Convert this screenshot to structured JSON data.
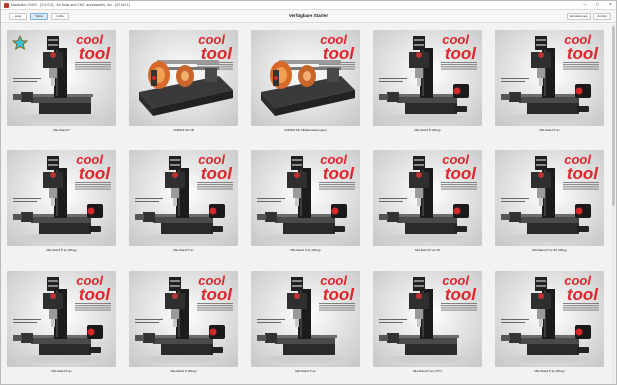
{
  "window": {
    "title": "Mackuino CNC2 - [2.0.0.0] - for tools and CNC accessories, Inc - [32 sel 1]",
    "min_glyph": "–",
    "max_glyph": "□",
    "close_glyph": "×"
  },
  "toolbar": {
    "buttons": [
      {
        "label": "Lista",
        "active": false
      },
      {
        "label": "Tabla",
        "active": true
      },
      {
        "label": "Grilla",
        "active": false
      }
    ],
    "title": "Verfügbare Starter",
    "right_buttons": [
      {
        "label": "Einstellungen"
      },
      {
        "label": "Zurück"
      }
    ]
  },
  "brand": {
    "line1": "cool",
    "line2": "tool",
    "color": "#e0252c"
  },
  "tiles": [
    {
      "label": "MH-Stand P",
      "kind": "mill",
      "favorite": true
    },
    {
      "label": "UNIMAT ML 1B",
      "kind": "lathe",
      "favorite": false
    },
    {
      "label": "UNIMAT ML 1B (Erweiterungen)",
      "kind": "lathe",
      "favorite": false
    },
    {
      "label": "MH-Stand P (3Zug)",
      "kind": "mill_motor",
      "favorite": false
    },
    {
      "label": "MH-Stand P ax",
      "kind": "mill_motor",
      "favorite": false
    },
    {
      "label": "MH-Stand P ax (3Zug)",
      "kind": "mill_motor",
      "favorite": false
    },
    {
      "label": "MH-Stand P ax",
      "kind": "mill_motor",
      "favorite": false
    },
    {
      "label": "MH-Stand P ax (3Zug)",
      "kind": "mill_motor",
      "favorite": false
    },
    {
      "label": "MH-Stand P ax XZ",
      "kind": "mill_motor",
      "favorite": false
    },
    {
      "label": "MH-Stand P ax XZ (3Zug)",
      "kind": "mill_motor",
      "favorite": false
    },
    {
      "label": "MH-Stand P ax",
      "kind": "mill_motor",
      "favorite": false
    },
    {
      "label": "MH-Stand P (3Zug)",
      "kind": "mill_motor",
      "favorite": false
    },
    {
      "label": "MH-Stand P ax",
      "kind": "mill",
      "favorite": false
    },
    {
      "label": "MH-Stand P ax (TXY)",
      "kind": "mill",
      "favorite": false
    },
    {
      "label": "MH-Stand P ax (3Zug)",
      "kind": "mill_motor",
      "favorite": false
    }
  ]
}
